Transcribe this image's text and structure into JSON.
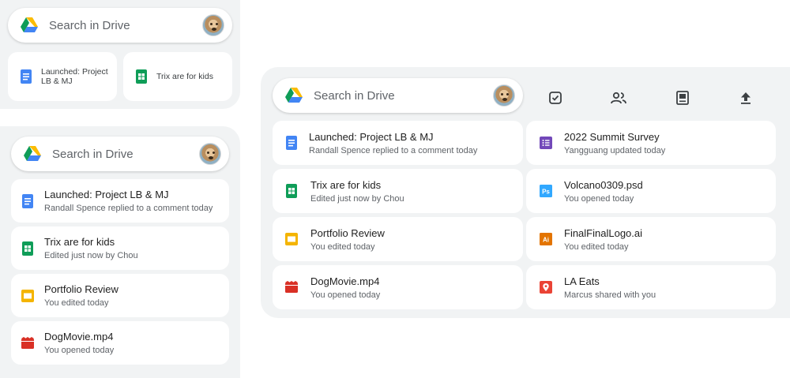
{
  "search": {
    "placeholder": "Search in Drive"
  },
  "compact_widget": {
    "files": [
      {
        "title": "Launched: Project LB & MJ",
        "icon": "google-docs-icon"
      },
      {
        "title": "Trix are for kids",
        "icon": "google-sheets-icon"
      }
    ]
  },
  "list_widget": {
    "files": [
      {
        "title": "Launched: Project LB & MJ",
        "subtitle": "Randall Spence replied to a comment today",
        "icon": "google-docs-icon"
      },
      {
        "title": "Trix are for kids",
        "subtitle": "Edited just now by Chou",
        "icon": "google-sheets-icon"
      },
      {
        "title": "Portfolio Review",
        "subtitle": "You edited today",
        "icon": "google-slides-icon"
      },
      {
        "title": "DogMovie.mp4",
        "subtitle": "You opened today",
        "icon": "video-file-icon"
      }
    ]
  },
  "large_widget": {
    "actions": [
      "task-check-icon",
      "shared-people-icon",
      "scan-document-icon",
      "upload-icon"
    ],
    "left_files": [
      {
        "title": "Launched: Project LB & MJ",
        "subtitle": "Randall Spence replied to a comment today",
        "icon": "google-docs-icon"
      },
      {
        "title": "Trix are for kids",
        "subtitle": "Edited just now by Chou",
        "icon": "google-sheets-icon"
      },
      {
        "title": "Portfolio Review",
        "subtitle": "You edited today",
        "icon": "google-slides-icon"
      },
      {
        "title": "DogMovie.mp4",
        "subtitle": "You opened today",
        "icon": "video-file-icon"
      }
    ],
    "right_files": [
      {
        "title": "2022 Summit Survey",
        "subtitle": "Yangguang updated today",
        "icon": "google-forms-icon"
      },
      {
        "title": "Volcano0309.psd",
        "subtitle": "You opened today",
        "icon": "photoshop-file-icon",
        "badge": "Ps"
      },
      {
        "title": "FinalFinalLogo.ai",
        "subtitle": "You edited today",
        "icon": "illustrator-file-icon",
        "badge": "Ai"
      },
      {
        "title": "LA Eats",
        "subtitle": "Marcus shared with you",
        "icon": "map-pin-file-icon"
      }
    ]
  },
  "colors": {
    "docs": "#4285f4",
    "sheets": "#0f9d58",
    "slides": "#f4b400",
    "video": "#d93025",
    "forms": "#7248b9",
    "photoshop": "#31a8ff",
    "illustrator": "#e37400",
    "map": "#ea4335"
  }
}
